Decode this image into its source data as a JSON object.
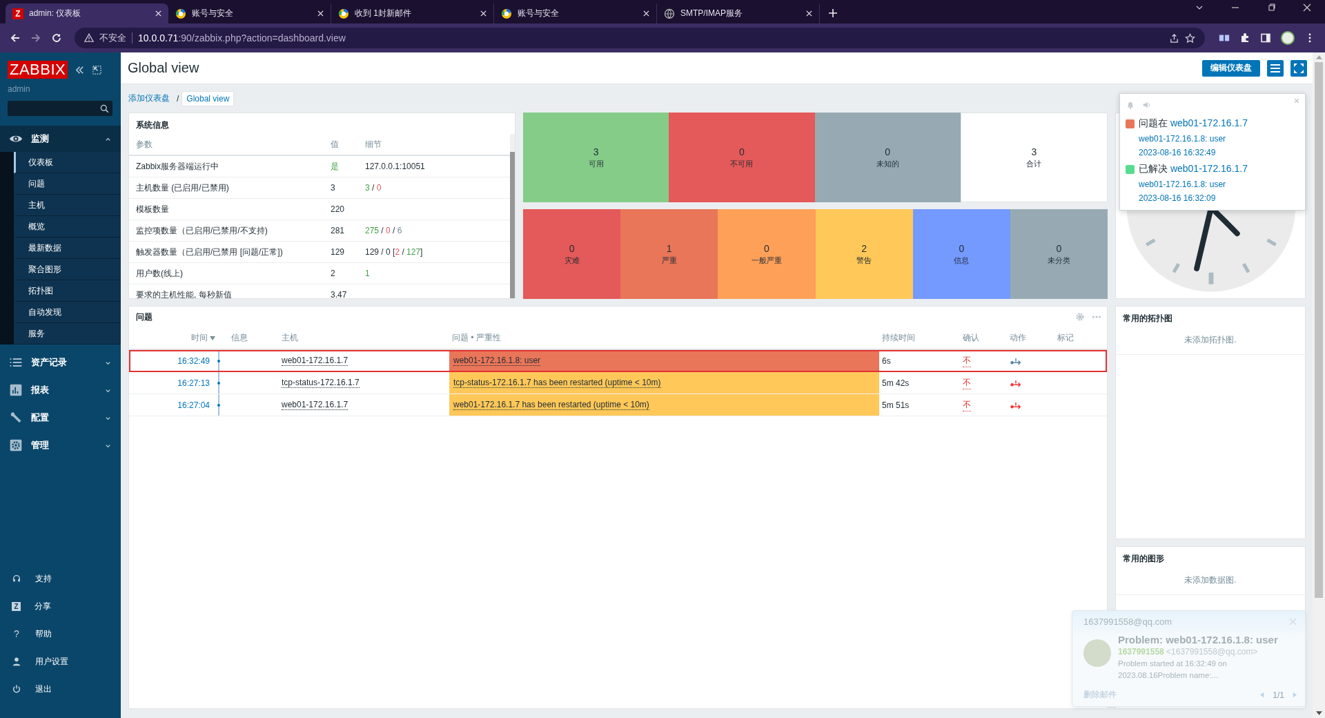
{
  "browser": {
    "tabs": [
      {
        "title": "admin: 仪表板",
        "selected": true,
        "favicon_text": "Z"
      },
      {
        "title": "账号与安全",
        "selected": false
      },
      {
        "title": "收到 1封新邮件",
        "selected": false
      },
      {
        "title": "账号与安全",
        "selected": false
      },
      {
        "title": "SMTP/IMAP服务",
        "selected": false
      }
    ],
    "address": {
      "security": "不安全",
      "host": "10.0.0.71",
      "path": ":90/zabbix.php?action=dashboard.view"
    }
  },
  "sidebar": {
    "logo": "ZABBIX",
    "user": "admin",
    "menu": [
      {
        "label": "监测",
        "expanded": true,
        "children": [
          {
            "label": "仪表板",
            "selected": true
          },
          {
            "label": "问题",
            "selected": false
          },
          {
            "label": "主机",
            "selected": false
          },
          {
            "label": "概览",
            "selected": false
          },
          {
            "label": "最新数据",
            "selected": false
          },
          {
            "label": "聚合图形",
            "selected": false
          },
          {
            "label": "拓扑图",
            "selected": false
          },
          {
            "label": "自动发现",
            "selected": false
          },
          {
            "label": "服务",
            "selected": false
          }
        ]
      },
      {
        "label": "资产记录",
        "expanded": false
      },
      {
        "label": "报表",
        "expanded": false
      },
      {
        "label": "配置",
        "expanded": false
      },
      {
        "label": "管理",
        "expanded": false
      }
    ],
    "footer": [
      {
        "label": "支持"
      },
      {
        "label": "分享",
        "icon_text": "Z"
      },
      {
        "label": "帮助",
        "icon_text": "?"
      },
      {
        "label": "用户设置"
      },
      {
        "label": "退出"
      }
    ]
  },
  "header": {
    "title": "Global view",
    "edit_button": "编辑仪表盘"
  },
  "breadcrumb": {
    "separator": "/",
    "items": [
      {
        "label": "添加仪表盘",
        "selected": false
      },
      {
        "label": "Global view",
        "selected": true
      }
    ]
  },
  "system_info": {
    "title": "系统信息",
    "columns": [
      "参数",
      "值",
      "细节"
    ],
    "rows": [
      {
        "param": "Zabbix服务器端运行中",
        "value": {
          "text": "是",
          "kind": "ok"
        },
        "details": [
          {
            "text": "127.0.0.1:10051",
            "kind": "normal"
          }
        ]
      },
      {
        "param": "主机数量 (已启用/已禁用)",
        "value": {
          "text": "3",
          "kind": "normal"
        },
        "details": [
          {
            "text": "3",
            "kind": "ok"
          },
          {
            "text": " / ",
            "kind": "normal"
          },
          {
            "text": "0",
            "kind": "problem"
          }
        ]
      },
      {
        "param": "模板数量",
        "value": {
          "text": "220",
          "kind": "normal"
        }
      },
      {
        "param": "监控项数量（已启用/已禁用/不支持)",
        "value": {
          "text": "281",
          "kind": "normal"
        },
        "details": [
          {
            "text": "275",
            "kind": "ok"
          },
          {
            "text": " / ",
            "kind": "normal"
          },
          {
            "text": "0",
            "kind": "problem"
          },
          {
            "text": " / ",
            "kind": "normal"
          },
          {
            "text": "6",
            "kind": "muted"
          }
        ]
      },
      {
        "param": "触发器数量（已启用/已禁用 [问题/正常])",
        "value": {
          "text": "129",
          "kind": "normal"
        },
        "details": [
          {
            "text": "129 / 0 [",
            "kind": "normal"
          },
          {
            "text": "2",
            "kind": "problem"
          },
          {
            "text": " / ",
            "kind": "normal"
          },
          {
            "text": "127",
            "kind": "ok"
          },
          {
            "text": "]",
            "kind": "normal"
          }
        ]
      },
      {
        "param": "用户数(线上)",
        "value": {
          "text": "2",
          "kind": "normal"
        },
        "details": [
          {
            "text": "1",
            "kind": "ok"
          }
        ]
      },
      {
        "param": "要求的主机性能, 每秒新值",
        "value": {
          "text": "3.47",
          "kind": "normal"
        }
      }
    ]
  },
  "host_availability": [
    {
      "count": "3",
      "label": "可用",
      "color": "#86cc89"
    },
    {
      "count": "0",
      "label": "不可用",
      "color": "#e45959"
    },
    {
      "count": "0",
      "label": "未知的",
      "color": "#97aab3"
    },
    {
      "count": "3",
      "label": "合计",
      "color": "#ffffff"
    }
  ],
  "problems_by_severity": [
    {
      "count": "0",
      "label": "灾难",
      "color": "#e45959"
    },
    {
      "count": "1",
      "label": "严重",
      "color": "#e97659"
    },
    {
      "count": "0",
      "label": "一般严重",
      "color": "#ffa059"
    },
    {
      "count": "2",
      "label": "警告",
      "color": "#ffc859"
    },
    {
      "count": "0",
      "label": "信息",
      "color": "#7499ff"
    },
    {
      "count": "0",
      "label": "未分类",
      "color": "#97aab3"
    }
  ],
  "problems": {
    "title": "问题",
    "columns": [
      "时间",
      "信息",
      "主机",
      "问题 • 严重性",
      "持续时间",
      "确认",
      "动作",
      "标记"
    ],
    "rows": [
      {
        "time": "16:32:49",
        "host": "web01-172.16.1.7",
        "problem": "web01-172.16.1.8: user",
        "color": "#e97659",
        "duration": "6s",
        "ack": "不",
        "action_failed": false,
        "highlighted": true
      },
      {
        "time": "16:27:13",
        "host": "tcp-status-172.16.1.7",
        "problem": "tcp-status-172.16.1.7 has been restarted (uptime < 10m)",
        "color": "#ffc859",
        "duration": "5m 42s",
        "ack": "不",
        "action_failed": true,
        "highlighted": false
      },
      {
        "time": "16:27:04",
        "host": "web01-172.16.1.7",
        "problem": "web01-172.16.1.7 has been restarted (uptime < 10m)",
        "color": "#ffc859",
        "duration": "5m 51s",
        "ack": "不",
        "action_failed": true,
        "highlighted": false
      }
    ]
  },
  "notification_popup": {
    "items": [
      {
        "status": "问题在",
        "host": "web01-172.16.1.7",
        "detail": "web01-172.16.1.8: user",
        "time": "2023-08-16 16:32:49",
        "color": "#e97659"
      },
      {
        "status": "已解决",
        "host": "web01-172.16.1.7",
        "detail": "web01-172.16.1.8: user",
        "time": "2023-08-16 16:32:09",
        "color": "#59db8f"
      }
    ]
  },
  "favorite_maps": {
    "title": "常用的拓扑图",
    "empty": "未添加拓扑图."
  },
  "favorite_graphs": {
    "title": "常用的图形",
    "empty": "未添加数据图."
  },
  "mail_toast": {
    "account": "1637991558@qq.com",
    "subject": "Problem: web01-172.16.1.8: user",
    "sender_name": "1637991558",
    "sender_address": "<1637991558@qq.com>",
    "preview": "Problem started at 16:32:49 on 2023.08.16Problem name:...",
    "delete": "删除邮件",
    "pager": "1/1"
  }
}
